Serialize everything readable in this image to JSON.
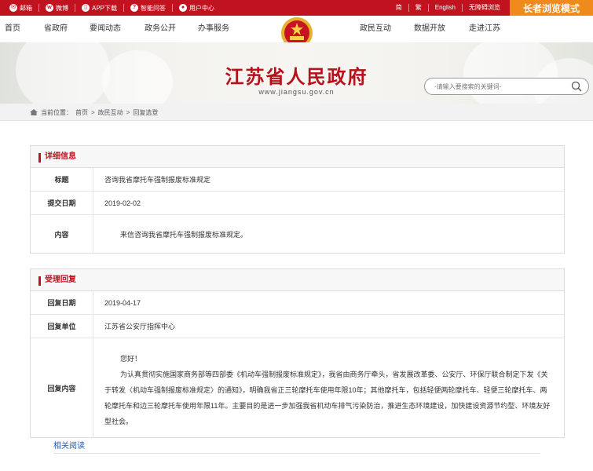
{
  "topbar": {
    "links": [
      {
        "icon": "mail-icon",
        "label": "邮箱"
      },
      {
        "icon": "weibo-icon",
        "label": "微博"
      },
      {
        "icon": "phone-icon",
        "label": "APP下载"
      },
      {
        "icon": "qa-icon",
        "label": "智能问答"
      },
      {
        "icon": "user-icon",
        "label": "用户中心"
      }
    ],
    "right_links": [
      "简",
      "繁",
      "English",
      "无障碍浏览"
    ],
    "elder_mode": "长者浏览模式"
  },
  "nav": {
    "left": [
      "首页",
      "省政府",
      "要闻动态",
      "政务公开",
      "办事服务"
    ],
    "right": [
      "政民互动",
      "数据开放",
      "走进江苏"
    ]
  },
  "banner": {
    "title": "江苏省人民政府",
    "domain": "www.jiangsu.gov.cn"
  },
  "search": {
    "placeholder": "-请输入要搜索的关键词-"
  },
  "breadcrumb": {
    "prefix": "当前位置：",
    "items": [
      "首页",
      "政民互动",
      "回复选登"
    ],
    "separator": ">"
  },
  "detail": {
    "heading": "详细信息",
    "rows": [
      {
        "label": "标题",
        "value": "咨询我省摩托车强制报废标准规定"
      },
      {
        "label": "提交日期",
        "value": "2019-02-02"
      },
      {
        "label": "内容",
        "value": "来信咨询我省摩托车强制报废标准规定。"
      }
    ]
  },
  "reply": {
    "heading": "受理回复",
    "date_label": "回复日期",
    "date": "2019-04-17",
    "unit_label": "回复单位",
    "unit": "江苏省公安厅指挥中心",
    "content_label": "回复内容",
    "greeting": "您好！",
    "body": "为认真贯彻实施国家商务部等四部委《机动车强制报废标准规定》，我省由商务厅牵头，省发展改革委、公安厅、环保厅联合制定下发《关于转发〈机动车强制报废标准规定〉的通知》，明确我省正三轮摩托车使用年限10年；其他摩托车，包括轻便两轮摩托车、轻便三轮摩托车、两轮摩托车和边三轮摩托车使用年限11年。主要目的是进一步加强我省机动车排气污染防治，推进生态环境建设，加快建设资源节约型、环境友好型社会。"
  },
  "related": "相关阅读",
  "colors": {
    "brand_red": "#c1121f",
    "elder_orange": "#f08a1c",
    "link_blue": "#1a5fb4"
  }
}
